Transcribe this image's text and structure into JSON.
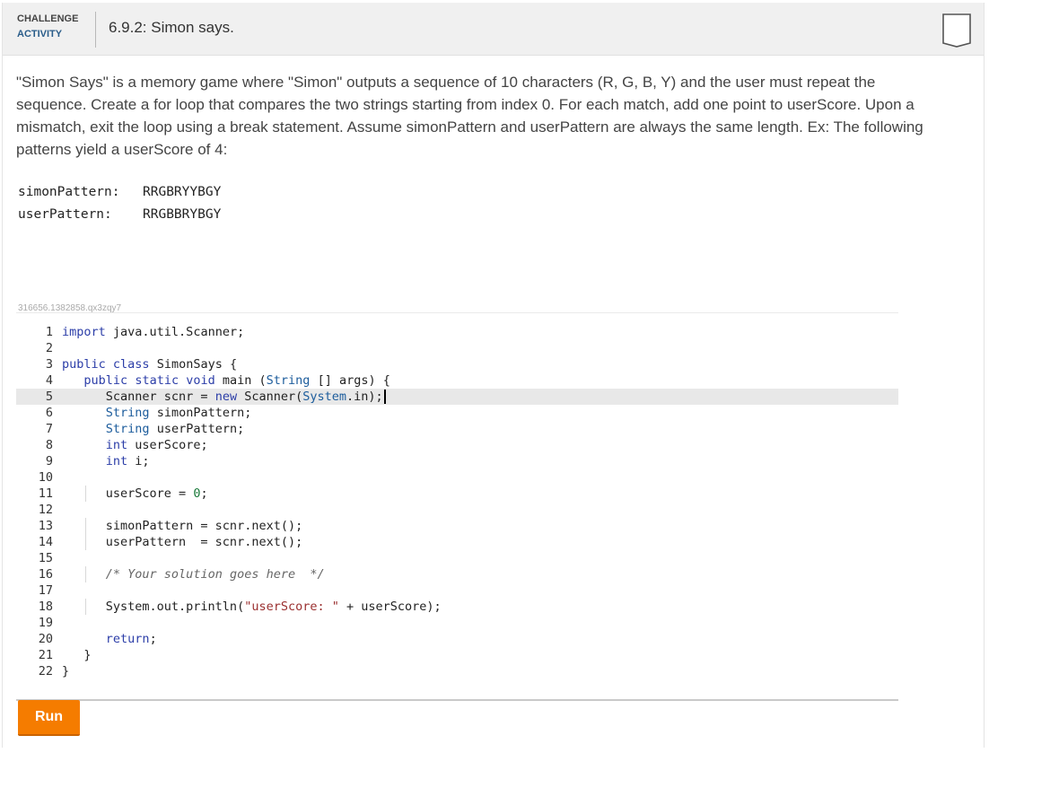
{
  "header": {
    "badge_line1": "CHALLENGE",
    "badge_line2": "ACTIVITY",
    "title": "6.9.2: Simon says."
  },
  "description": "\"Simon Says\" is a memory game where \"Simon\" outputs a sequence of 10 characters (R, G, B, Y) and the user must repeat the sequence. Create a for loop that compares the two strings starting from index 0. For each match, add one point to userScore. Upon a mismatch, exit the loop using a break statement. Assume simonPattern and userPattern are always the same length. Ex: The following patterns yield a userScore of 4:",
  "patterns": [
    {
      "label": "simonPattern:",
      "value": "RRGBRYYBGY"
    },
    {
      "label": "userPattern:",
      "value": "RRGBBRYBGY"
    }
  ],
  "code_id": "316656.1382858.qx3zqy7",
  "editor": {
    "active_line": 5,
    "lines": [
      {
        "n": "1",
        "html": "<span class='kw'>import</span> java.util.Scanner;"
      },
      {
        "n": "2",
        "html": ""
      },
      {
        "n": "3",
        "html": "<span class='kw'>public</span> <span class='kw'>class</span> SimonSays {"
      },
      {
        "n": "4",
        "html": "   <span class='kw'>public</span> <span class='kw'>static</span> <span class='kw'>void</span> main (<span class='ty'>String</span> [] args) {"
      },
      {
        "n": "5",
        "html": "      Scanner scnr = <span class='kw'>new</span> Scanner(<span class='ty'>System</span>.in);"
      },
      {
        "n": "6",
        "html": "      <span class='ty'>String</span> simonPattern;"
      },
      {
        "n": "7",
        "html": "      <span class='ty'>String</span> userPattern;"
      },
      {
        "n": "8",
        "html": "      <span class='kw'>int</span> userScore;"
      },
      {
        "n": "9",
        "html": "      <span class='kw'>int</span> i;"
      },
      {
        "n": "10",
        "html": ""
      },
      {
        "n": "11",
        "html": "      userScore = <span class='num'>0</span>;"
      },
      {
        "n": "12",
        "html": ""
      },
      {
        "n": "13",
        "html": "      simonPattern = scnr.next();"
      },
      {
        "n": "14",
        "html": "      userPattern  = scnr.next();"
      },
      {
        "n": "15",
        "html": ""
      },
      {
        "n": "16",
        "html": "      <span class='cm'>/* Your solution goes here  */</span>"
      },
      {
        "n": "17",
        "html": ""
      },
      {
        "n": "18",
        "html": "      System.out.println(<span class='str'>\"userScore: \"</span> + userScore);"
      },
      {
        "n": "19",
        "html": ""
      },
      {
        "n": "20",
        "html": "      <span class='kw'>return</span>;"
      },
      {
        "n": "21",
        "html": "   }"
      },
      {
        "n": "22",
        "html": "}"
      }
    ]
  },
  "run_label": "Run",
  "colors": {
    "run_button": "#f57c00",
    "keyword": "#2c3ea8",
    "header_bg": "#f0f0f0"
  },
  "icons": {
    "bookmark": "bookmark-icon"
  }
}
